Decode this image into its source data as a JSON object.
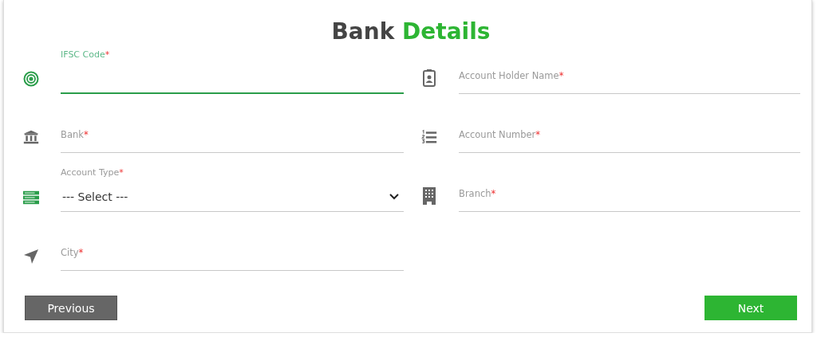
{
  "title": {
    "text": "Bank",
    "highlight": "Details"
  },
  "fields": [
    {
      "kind": "text",
      "label": "IFSC Code",
      "required_mark": "*",
      "focused": true
    },
    {
      "kind": "text",
      "label": "Account Holder Name",
      "required_mark": "*",
      "focused": false
    },
    {
      "kind": "text",
      "label": "Bank",
      "required_mark": "*",
      "focused": false
    },
    {
      "kind": "text",
      "label": "Account Number",
      "required_mark": "*",
      "focused": false
    },
    {
      "kind": "select",
      "label": "Account Type",
      "required_mark": "*",
      "value": "--- Select ---",
      "focused": false
    },
    {
      "kind": "text",
      "label": "Branch",
      "required_mark": "*",
      "focused": false
    },
    {
      "kind": "text",
      "label": "City",
      "required_mark": "*",
      "focused": false
    }
  ],
  "buttons": [
    {
      "label": "Previous",
      "kind": "secondary"
    },
    {
      "label": "Next",
      "kind": "primary"
    }
  ]
}
